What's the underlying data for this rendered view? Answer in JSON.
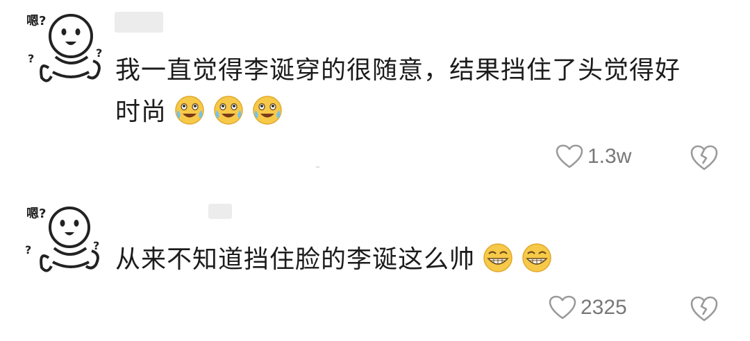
{
  "comments": [
    {
      "avatar_tag": "嗯?",
      "text": "我一直觉得李诞穿的很随意，结果挡住了头觉得好时尚",
      "emojis": [
        "laugh-cry-icon",
        "laugh-cry-icon",
        "laugh-cry-icon"
      ],
      "like_count": "1.3w"
    },
    {
      "avatar_tag": "嗯?",
      "text": "从来不知道挡住脸的李诞这么帅",
      "emojis": [
        "grin-icon",
        "grin-icon"
      ],
      "like_count": "2325"
    }
  ],
  "colors": {
    "text": "#1c1c1c",
    "count": "#777777",
    "icon": "#9a9a9a",
    "emoji_face": "#f7c948"
  }
}
